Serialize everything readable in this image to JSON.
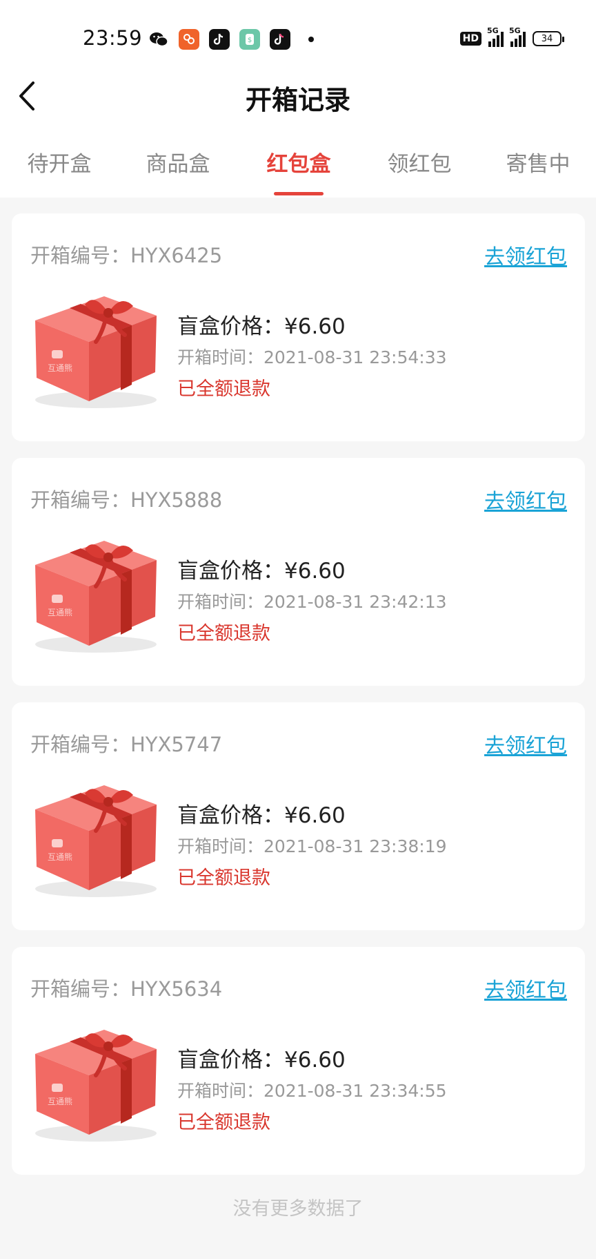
{
  "status_bar": {
    "time": "23:59",
    "hd_label": "HD",
    "network_1": "5G",
    "network_2": "5G",
    "battery": "34",
    "icons": [
      "wechat-icon",
      "app-icon-orange",
      "tiktok-icon-1",
      "green-app-icon",
      "tiktok-icon-2"
    ]
  },
  "header": {
    "title": "开箱记录"
  },
  "tabs": [
    {
      "label": "待开盒"
    },
    {
      "label": "商品盒"
    },
    {
      "label": "红包盒"
    },
    {
      "label": "领红包"
    },
    {
      "label": "寄售中"
    }
  ],
  "active_tab": "红包盒",
  "records": [
    {
      "box_no": "开箱编号：HYX6425",
      "claim": "去领红包",
      "price": "盲盒价格：¥6.60",
      "open_time": "开箱时间：2021-08-31 23:54:33",
      "status": "已全额退款",
      "box_text": "互通熊"
    },
    {
      "box_no": "开箱编号：HYX5888",
      "claim": "去领红包",
      "price": "盲盒价格：¥6.60",
      "open_time": "开箱时间：2021-08-31 23:42:13",
      "status": "已全额退款",
      "box_text": "互通熊"
    },
    {
      "box_no": "开箱编号：HYX5747",
      "claim": "去领红包",
      "price": "盲盒价格：¥6.60",
      "open_time": "开箱时间：2021-08-31 23:38:19",
      "status": "已全额退款",
      "box_text": "互通熊"
    },
    {
      "box_no": "开箱编号：HYX5634",
      "claim": "去领红包",
      "price": "盲盒价格：¥6.60",
      "open_time": "开箱时间：2021-08-31 23:34:55",
      "status": "已全额退款",
      "box_text": "互通熊"
    }
  ],
  "footer_text": "没有更多数据了",
  "colors": {
    "accent": "#e5433b",
    "link": "#1aa3d6",
    "refund": "#d9372e",
    "gift_box": "#f4706b"
  }
}
